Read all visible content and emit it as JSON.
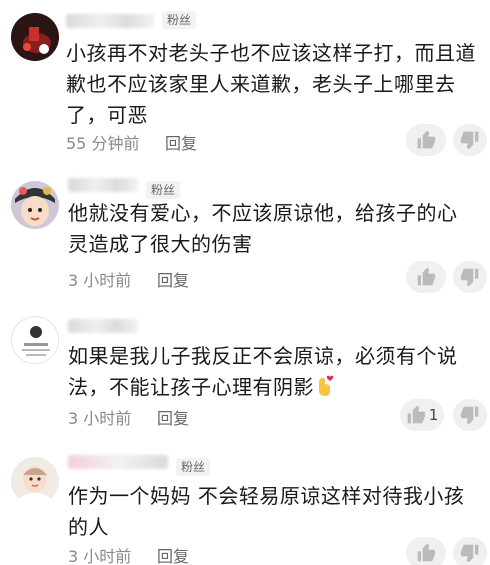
{
  "comments": [
    {
      "badge": "粉丝",
      "text": "小孩再不对老头子也不应该这样子打，而且道歉也不应该家里人来道歉，老头子上哪里去了，可恶",
      "time": "55 分钟前",
      "reply": "回复",
      "likes": "",
      "avatar": "dark-red-lamp"
    },
    {
      "badge": "粉丝",
      "text": "他就没有爱心，不应该原谅他，给孩子的心灵造成了很大的伤害",
      "time": "3 小时前",
      "reply": "回复",
      "likes": "",
      "avatar": "child-portrait"
    },
    {
      "badge": "",
      "text": "如果是我儿子我反正不会原谅，必须有个说法，不能让孩子心理有阴影",
      "time": "3 小时前",
      "reply": "回复",
      "likes": "1",
      "avatar": "cartoon-text"
    },
    {
      "badge": "粉丝",
      "text": "作为一个妈妈 不会轻易原谅这样对待我小孩的人",
      "time": "3 小时前",
      "reply": "回复",
      "likes": "",
      "avatar": "baby-portrait"
    }
  ],
  "colors": {
    "text": "#1a1a1a",
    "meta": "#8a8a8a",
    "button_bg": "#f0f0f0",
    "icon": "#bbbbbb"
  }
}
